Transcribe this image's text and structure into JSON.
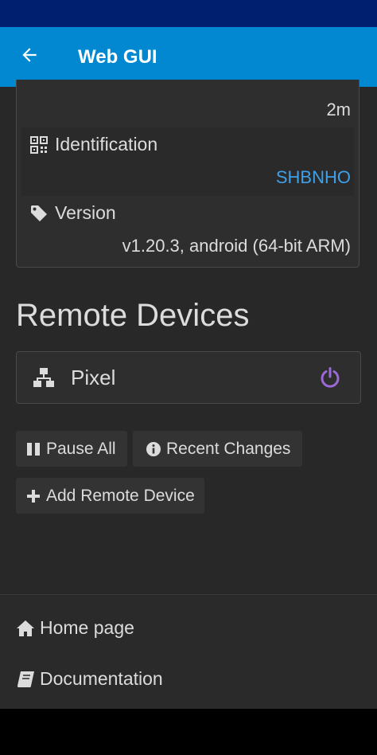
{
  "header": {
    "title": "Web GUI"
  },
  "device_info": {
    "uptime_value": "2m",
    "identification": {
      "label": "Identification",
      "value": "SHBNHO"
    },
    "version": {
      "label": "Version",
      "value": "v1.20.3, android (64-bit ARM)"
    }
  },
  "remote_devices": {
    "title": "Remote Devices",
    "devices": [
      {
        "name": "Pixel"
      }
    ]
  },
  "actions": {
    "pause_all": "Pause All",
    "recent_changes": "Recent Changes",
    "add_remote_device": "Add Remote Device"
  },
  "footer": {
    "home_page": "Home page",
    "documentation": "Documentation"
  },
  "colors": {
    "app_bar": "#0288d1",
    "status_bar": "#00206f",
    "link_blue": "#3fa0e8",
    "power_purple": "#9c6ad6",
    "background": "#282828"
  },
  "icons": {
    "back": "arrow-left-icon",
    "identification": "qrcode-icon",
    "version": "tag-icon",
    "device": "sitemap-icon",
    "power": "power-icon",
    "pause": "pause-icon",
    "info": "info-circle-icon",
    "add": "plus-icon",
    "home": "home-icon",
    "docs": "book-icon"
  }
}
